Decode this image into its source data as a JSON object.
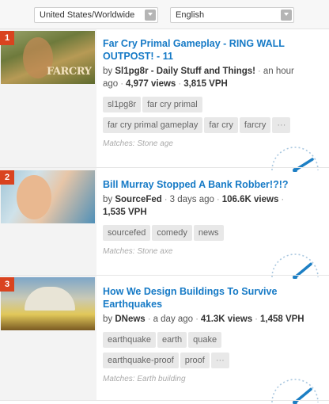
{
  "filters": {
    "region": "United States/Worldwide",
    "language": "English"
  },
  "videos": [
    {
      "rank": "1",
      "title": "Far Cry Primal Gameplay - RING WALL OUTPOST! - 11",
      "by": "by",
      "channel": "Sl1pg8r - Daily Stuff and Things!",
      "age": "an hour ago",
      "views": "4,977 views",
      "vph": "3,815 VPH",
      "thumb_text": "FARCRY",
      "tags": [
        "sl1pg8r",
        "far cry primal",
        "far cry primal gameplay",
        "far cry",
        "farcry",
        "···"
      ],
      "matches": "Matches: Stone age",
      "gauge_level": 0.82
    },
    {
      "rank": "2",
      "title": "Bill Murray Stopped A Bank Robber!?!?",
      "by": "by",
      "channel": "SourceFed",
      "age": "3 days ago",
      "views": "106.6K views",
      "vph": "1,535 VPH",
      "tags": [
        "sourcefed",
        "comedy",
        "news"
      ],
      "matches": "Matches: Stone axe",
      "gauge_level": 0.78
    },
    {
      "rank": "3",
      "title": "How We Design Buildings To Survive Earthquakes",
      "by": "by",
      "channel": "DNews",
      "age": "a day ago",
      "views": "41.3K views",
      "vph": "1,458 VPH",
      "tags": [
        "earthquake",
        "earth",
        "quake",
        "earthquake-proof",
        "proof",
        "···"
      ],
      "matches": "Matches: Earth building",
      "gauge_level": 0.78
    }
  ],
  "colors": {
    "title_link": "#167ac6",
    "rank_badge": "#d9431f",
    "gauge_needle": "#1d7fc4"
  }
}
